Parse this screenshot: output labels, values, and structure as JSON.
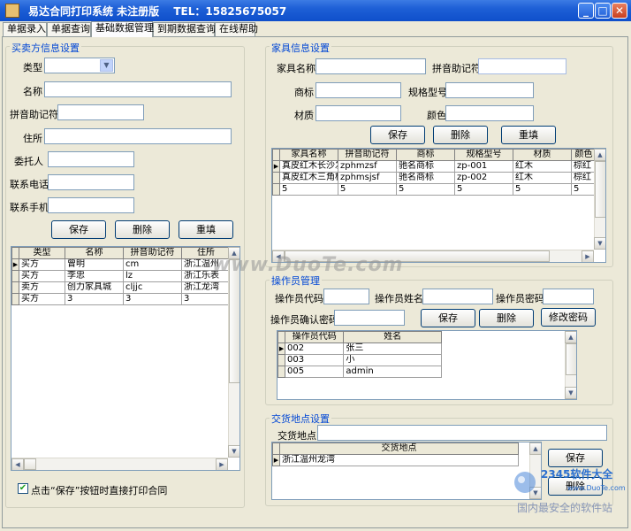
{
  "window": {
    "title": "易达合同打印系统 未注册版　 TEL：15825675057"
  },
  "tabs": [
    "单据录入",
    "单据查询",
    "基础数据管理",
    "到期数据查询",
    "在线帮助"
  ],
  "buyer": {
    "legend": "买卖方信息设置",
    "type_label": "类型",
    "name_label": "名称",
    "pinyin_label": "拼音助记符",
    "address_label": "住所",
    "agent_label": "委托人",
    "phone_label": "联系电话",
    "mobile_label": "联系手机",
    "save": "保存",
    "delete": "删除",
    "refill": "重填",
    "grid": {
      "columns": [
        "类型",
        "名称",
        "拼音助记符",
        "住所"
      ],
      "rows": [
        [
          "买方",
          "曾明",
          "cm",
          "浙江温州"
        ],
        [
          "买方",
          "李忠",
          "lz",
          "浙江乐表"
        ],
        [
          "卖方",
          "创力家具城",
          "cljjc",
          "浙江龙湾"
        ],
        [
          "买方",
          "3",
          "3",
          "3"
        ]
      ]
    },
    "checkbox_label": "点击“保存”按钮时直接打印合同"
  },
  "furniture": {
    "legend": "家具信息设置",
    "name_label": "家具名称",
    "pinyin_label": "拼音助记符",
    "brand_label": "商标",
    "model_label": "规格型号",
    "material_label": "材质",
    "color_label": "颜色",
    "save": "保存",
    "delete": "删除",
    "refill": "重填",
    "grid": {
      "columns": [
        "家具名称",
        "拼音助记符",
        "商标",
        "规格型号",
        "材质",
        "颜色"
      ],
      "rows": [
        [
          "真皮红木长沙发",
          "zphmzsf",
          "驰名商标",
          "zp-001",
          "红木",
          "棕红"
        ],
        [
          "真皮红木三角柜",
          "zphmsjsf",
          "驰名商标",
          "zp-002",
          "红木",
          "棕红"
        ],
        [
          "5",
          "5",
          "5",
          "5",
          "5",
          "5"
        ]
      ]
    }
  },
  "operator": {
    "legend": "操作员管理",
    "code_label": "操作员代码",
    "name_label": "操作员姓名",
    "password_label": "操作员密码",
    "confirm_label": "操作员确认密码",
    "save": "保存",
    "delete": "删除",
    "change_password": "修改密码",
    "grid": {
      "columns": [
        "操作员代码",
        "姓名"
      ],
      "rows": [
        [
          "002",
          "张三"
        ],
        [
          "003",
          "小"
        ],
        [
          "005",
          "admin"
        ]
      ]
    }
  },
  "delivery": {
    "legend": "交货地点设置",
    "place_label": "交货地点",
    "save": "保存",
    "delete": "删除",
    "grid": {
      "columns": [
        "交货地点"
      ],
      "rows": [
        [
          "浙江温州龙湾"
        ]
      ]
    }
  },
  "watermark": "www.DuoTe.com",
  "brand": {
    "logo_text": "2345软件大全",
    "logo_url": "www.DuoTe.com",
    "slogan": "国内最安全的软件站"
  },
  "colors": {
    "titlebar": "#0f4fcb",
    "legend_text": "#0046d5",
    "panel": "#ece9d8"
  }
}
